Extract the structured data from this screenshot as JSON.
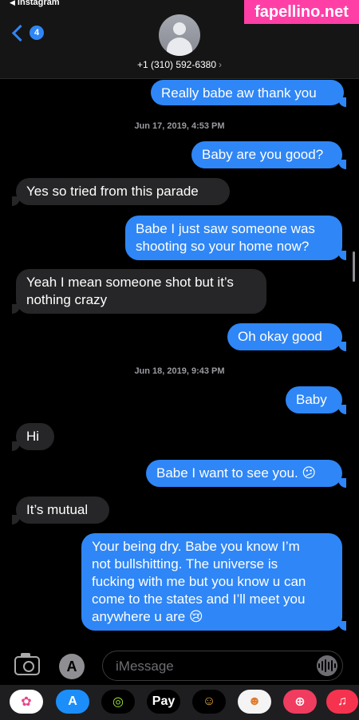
{
  "status": {
    "back_app": "Instagram"
  },
  "header": {
    "badge": "4",
    "contact": "+1 (310) 592-6380",
    "contact_chevron": "›"
  },
  "watermark": "fapellino.net",
  "messages": [
    {
      "type": "sent",
      "text": "Really babe aw thank you"
    },
    {
      "type": "stamp",
      "text": "Jun 17, 2019, 4:53 PM"
    },
    {
      "type": "sent",
      "text": "Baby are you good?"
    },
    {
      "type": "recv",
      "text": "Yes so tried from this parade"
    },
    {
      "type": "sent",
      "text": "Babe I just saw someone was\nshooting so your home now?"
    },
    {
      "type": "recv",
      "text": "Yeah I mean someone shot but it’s\nnothing crazy"
    },
    {
      "type": "sent",
      "text": "Oh okay good"
    },
    {
      "type": "stamp",
      "text": "Jun 18, 2019, 9:43 PM"
    },
    {
      "type": "sent",
      "text": "Baby"
    },
    {
      "type": "recv",
      "text": "Hi"
    },
    {
      "type": "sent",
      "text": "Babe I want to see you. 😕"
    },
    {
      "type": "recv",
      "text": "It’s mutual"
    },
    {
      "type": "sent",
      "text": "Your being dry. Babe you know I’m\nnot bullshitting. The universe is\nfucking with me but you know u can\ncome to the states and I’ll meet you\nanywhere u are 😢"
    }
  ],
  "compose": {
    "placeholder": "iMessage",
    "apps_glyph": "A"
  },
  "dock": [
    {
      "name": "photos",
      "label": "✿",
      "bg": "#ffffff",
      "fg": "#e8458b"
    },
    {
      "name": "app-store",
      "label": "A",
      "bg": "#1c8ef9",
      "fg": "#ffffff"
    },
    {
      "name": "activity",
      "label": "◎",
      "bg": "#000000",
      "fg": "#9fe33b"
    },
    {
      "name": "apple-pay",
      "label": "Pay",
      "bg": "#000000",
      "fg": "#ffffff"
    },
    {
      "name": "memoji",
      "label": "☺",
      "bg": "#000000",
      "fg": "#f2b33d"
    },
    {
      "name": "animoji",
      "label": "☻",
      "bg": "#f4f4f4",
      "fg": "#e07a2c"
    },
    {
      "name": "image-search",
      "label": "⊕",
      "bg": "#f03c5f",
      "fg": "#ffffff"
    },
    {
      "name": "music",
      "label": "♫",
      "bg": "#f6334f",
      "fg": "#ffffff"
    }
  ]
}
